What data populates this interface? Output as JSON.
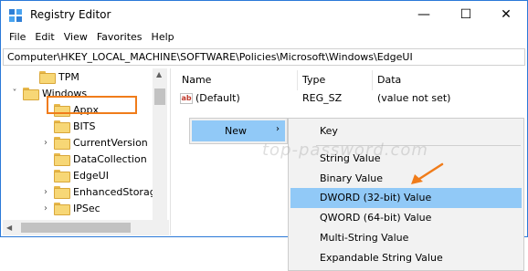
{
  "window": {
    "title": "Registry Editor",
    "controls": {
      "minimize": "—",
      "maximize": "☐",
      "close": "✕"
    }
  },
  "menubar": [
    "File",
    "Edit",
    "View",
    "Favorites",
    "Help"
  ],
  "address": "Computer\\HKEY_LOCAL_MACHINE\\SOFTWARE\\Policies\\Microsoft\\Windows\\EdgeUI",
  "tree": {
    "items": [
      {
        "label": "TPM"
      },
      {
        "label": "Windows"
      },
      {
        "label": "Appx"
      },
      {
        "label": "BITS"
      },
      {
        "label": "CurrentVersion"
      },
      {
        "label": "DataCollection"
      },
      {
        "label": "EdgeUI"
      },
      {
        "label": "EnhancedStorage"
      },
      {
        "label": "IPSec"
      }
    ]
  },
  "values_pane": {
    "columns": [
      "Name",
      "Type",
      "Data"
    ],
    "rows": [
      {
        "icon": "ab",
        "name": "(Default)",
        "type": "REG_SZ",
        "data": "(value not set)"
      }
    ]
  },
  "context_menu": {
    "new_label": "New",
    "submenu": [
      "Key",
      "String Value",
      "Binary Value",
      "DWORD (32-bit) Value",
      "QWORD (64-bit) Value",
      "Multi-String Value",
      "Expandable String Value"
    ],
    "highlighted": "DWORD (32-bit) Value"
  },
  "watermark": "top-password.com",
  "colors": {
    "highlight": "#91c9f7",
    "annotation": "#f07c1a",
    "folder": "#f7d776"
  }
}
